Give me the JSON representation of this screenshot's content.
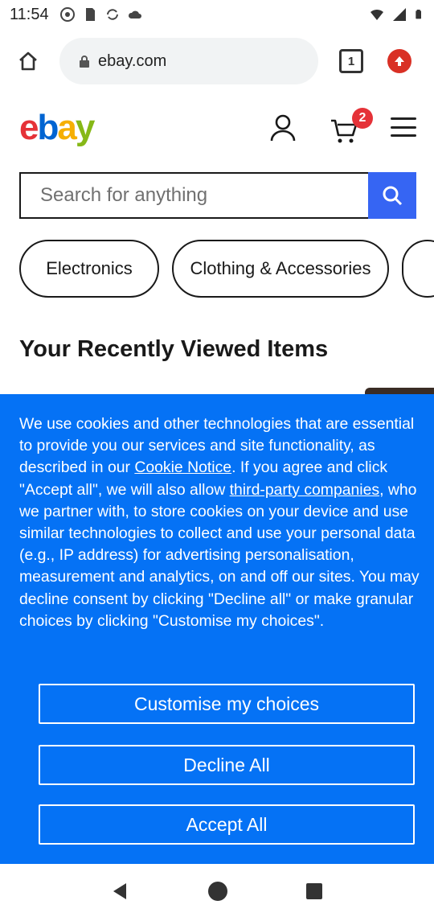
{
  "status_bar": {
    "time": "11:54"
  },
  "browser": {
    "url": "ebay.com",
    "tab_count": "1"
  },
  "ebay": {
    "logo_letters": [
      "e",
      "b",
      "a",
      "y"
    ],
    "logo_colors": [
      "#e53238",
      "#0064d2",
      "#f5af02",
      "#86b817"
    ],
    "cart_count": "2",
    "search_placeholder": "Search for anything",
    "categories": [
      "Electronics",
      "Clothing & Accessories"
    ],
    "recently_viewed_title": "Your Recently Viewed Items"
  },
  "cookie_banner": {
    "text_1": "We use cookies and other technologies that are essential to provide you our services and site functionality, as described in our ",
    "cookie_notice_link": "Cookie Notice",
    "text_2": ". If you agree and click \"Accept all\", we will also allow ",
    "third_party_link": "third-party companies",
    "text_3": ", who we partner with, to store cookies on your device and use similar technologies to collect and use your personal data (e.g., IP address) for advertising personalisation, measurement and analytics, on and off our sites. You may decline consent by clicking \"Decline all\" or make granular choices by clicking \"Customise my choices\".",
    "customise_label": "Customise my choices",
    "decline_label": "Decline All",
    "accept_label": "Accept All"
  }
}
